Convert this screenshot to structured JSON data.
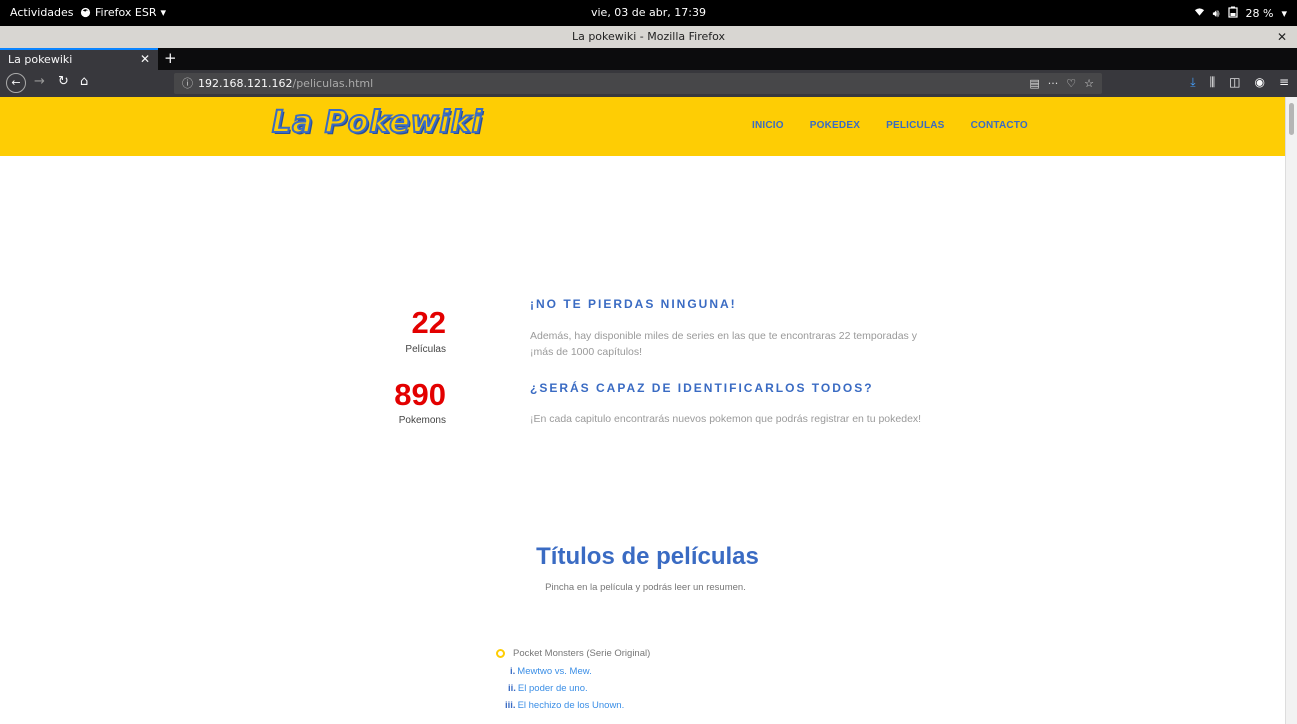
{
  "gnome": {
    "activities": "Actividades",
    "app_name": "Firefox ESR",
    "clock": "vie, 03 de abr, 17:39",
    "battery": "28 %"
  },
  "window": {
    "title": "La pokewiki - Mozilla Firefox"
  },
  "tab": {
    "label": "La pokewiki"
  },
  "urlbar": {
    "host": "192.168.121.162",
    "path": "/peliculas.html"
  },
  "site": {
    "logo_text": "La Pokewiki",
    "menu": [
      "INICIO",
      "POKEDEX",
      "PELICULAS",
      "CONTACTO"
    ]
  },
  "stats": [
    {
      "value": "22",
      "label": "Películas"
    },
    {
      "value": "890",
      "label": "Pokemons"
    }
  ],
  "sections": [
    {
      "heading": "¡NO TE PIERDAS NINGUNA!",
      "text": "Además, hay disponible miles de series en las que te encontraras 22 temporadas y ¡más de 1000 capítulos!"
    },
    {
      "heading": "¿SERÁS CAPAZ DE IDENTIFICARLOS TODOS?",
      "text": "¡En cada capitulo encontrarás nuevos pokemon que podrás registrar en tu pokedex!"
    }
  ],
  "films": {
    "title": "Títulos de películas",
    "subtitle": "Pincha en la película y podrás leer un resumen.",
    "series": "Pocket Monsters (Serie Original)",
    "items": [
      {
        "num": "i.",
        "title": "Mewtwo vs. Mew."
      },
      {
        "num": "ii.",
        "title": "El poder de uno."
      },
      {
        "num": "iii.",
        "title": "El hechizo de los Unown."
      }
    ]
  }
}
